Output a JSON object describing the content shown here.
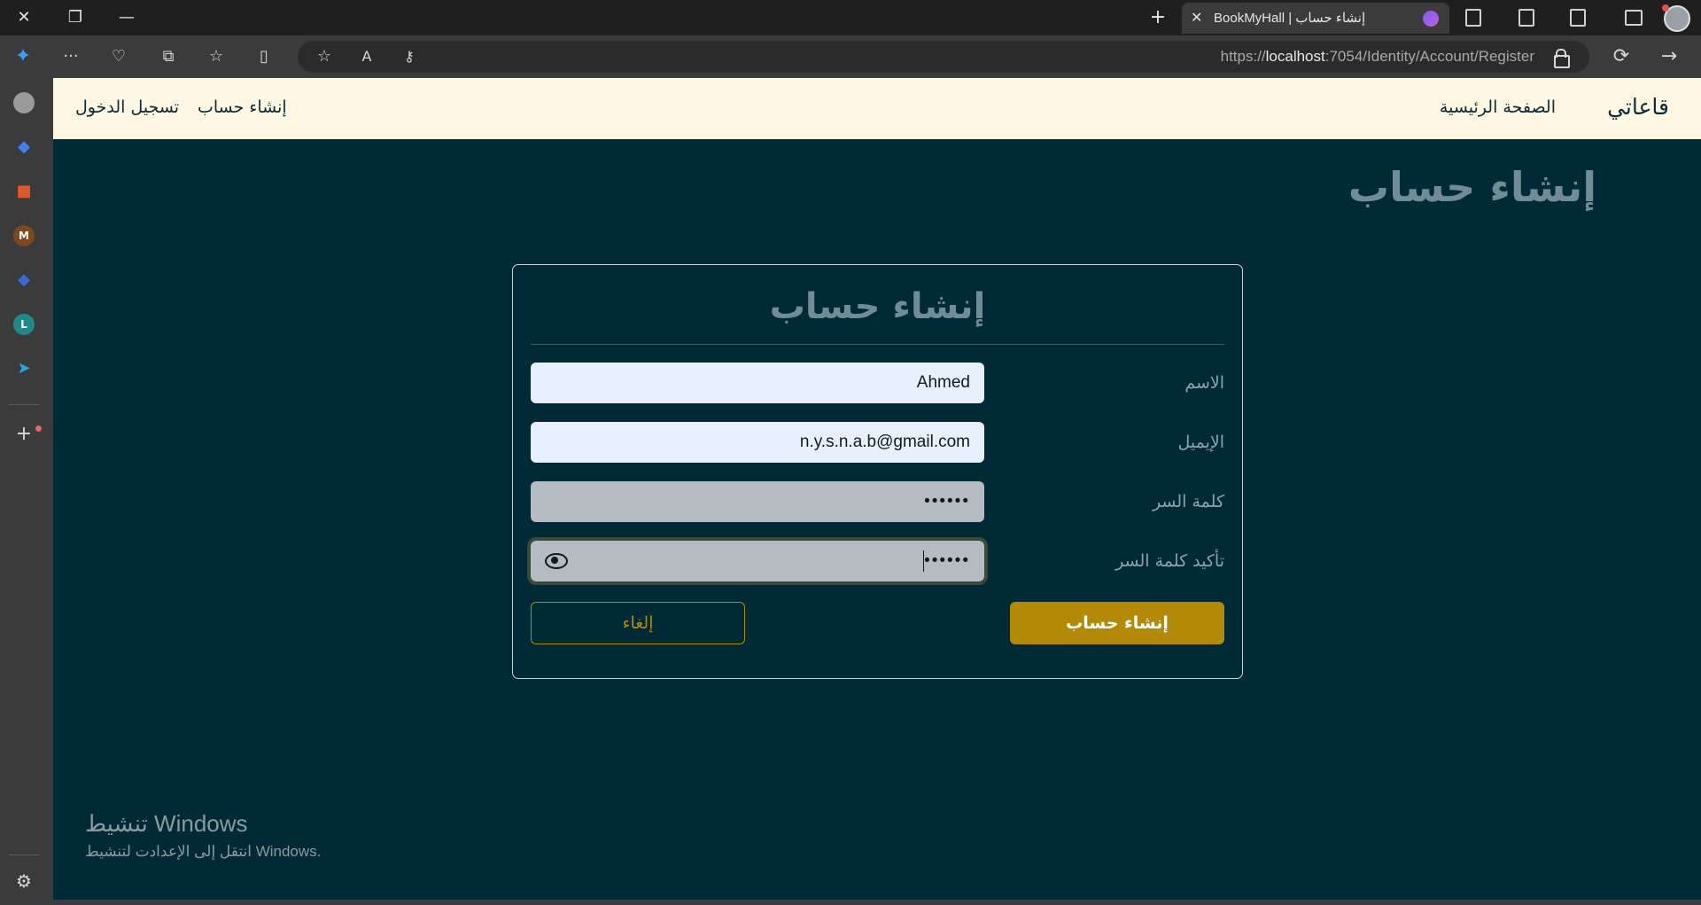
{
  "browser": {
    "tab_title": "BookMyHall | إنشاء حساب",
    "url_prefix": "https://",
    "url_host": "localhost",
    "url_path": ":7054/Identity/Account/Register"
  },
  "icons": {
    "close": "✕",
    "restore": "❐",
    "minimize": "—",
    "new_tab": "+",
    "more": "···",
    "favorites": "☆",
    "read_aloud": "A",
    "refresh": "⟳",
    "forward": "→",
    "add": "+",
    "settings": "⚙"
  },
  "sidebar": {
    "items": [
      {
        "glyph": "",
        "color": "#9a9a9a"
      },
      {
        "glyph": "◆",
        "color": "#3b82f6"
      },
      {
        "glyph": "■",
        "color": "#e0582a"
      },
      {
        "glyph": "M",
        "color": "#7a4a1a"
      },
      {
        "glyph": "◆",
        "color": "#3a6ad6"
      },
      {
        "glyph": "L",
        "color": "#1f8a8a"
      },
      {
        "glyph": "➤",
        "color": "#2aa7e0"
      }
    ]
  },
  "navbar": {
    "brand": "قاعاتي",
    "home": "الصفحة الرئيسية",
    "register": "إنشاء حساب",
    "login": "تسجيل الدخول"
  },
  "page": {
    "heading": "إنشاء حساب"
  },
  "form": {
    "title": "إنشاء حساب",
    "name_label": "الاسم",
    "name_value": "Ahmed",
    "email_label": "الإيميل",
    "email_value": "n.y.s.n.a.b@gmail.com",
    "password_label": "كلمة السر",
    "password_value": "••••••",
    "confirm_label": "تأكيد كلمة السر",
    "confirm_value": "••••••",
    "submit": "إنشاء حساب",
    "cancel": "إلغاء"
  },
  "watermark": {
    "title": "تنشيط Windows",
    "subtitle": "انتقل إلى الإعدادت لتنشيط Windows."
  }
}
